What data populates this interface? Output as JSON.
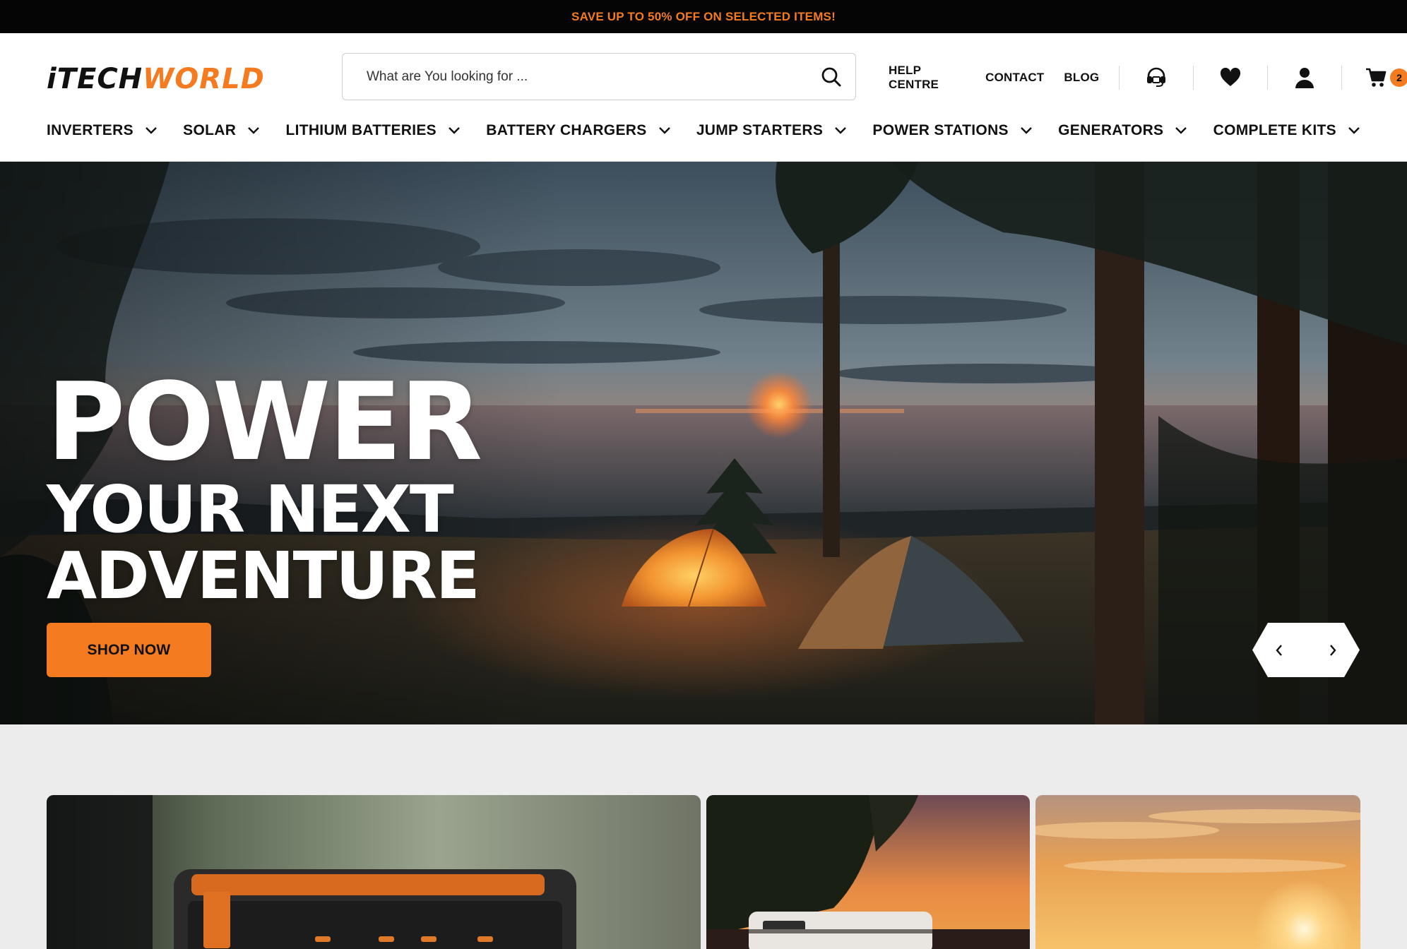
{
  "announcement": {
    "text": "SAVE UP TO 50% OFF ON SELECTED ITEMS!"
  },
  "brand": {
    "logo_part_a": "iTECH",
    "logo_part_b": "WORLD",
    "accent_color": "#f47b20"
  },
  "search": {
    "placeholder": "What are You looking for ..."
  },
  "utility_links": [
    {
      "label": "HELP CENTRE"
    },
    {
      "label": "CONTACT"
    },
    {
      "label": "BLOG"
    }
  ],
  "header_icons": {
    "support": "headset-icon",
    "wishlist": "heart-icon",
    "account": "user-icon",
    "cart": "cart-icon",
    "cart_count": "2"
  },
  "nav": [
    {
      "label": "INVERTERS"
    },
    {
      "label": "SOLAR"
    },
    {
      "label": "LITHIUM BATTERIES"
    },
    {
      "label": "BATTERY CHARGERS"
    },
    {
      "label": "JUMP STARTERS"
    },
    {
      "label": "POWER STATIONS"
    },
    {
      "label": "GENERATORS"
    },
    {
      "label": "COMPLETE KITS"
    }
  ],
  "hero": {
    "line1": "POWER",
    "line2": "YOUR NEXT",
    "line3": "ADVENTURE",
    "cta_label": "SHOP NOW",
    "prev_icon": "chevron-left-icon",
    "next_icon": "chevron-right-icon"
  },
  "promo_cards": [
    {
      "name": "power-station-card"
    },
    {
      "name": "caravan-sunset-card"
    },
    {
      "name": "sunset-sky-card"
    }
  ]
}
